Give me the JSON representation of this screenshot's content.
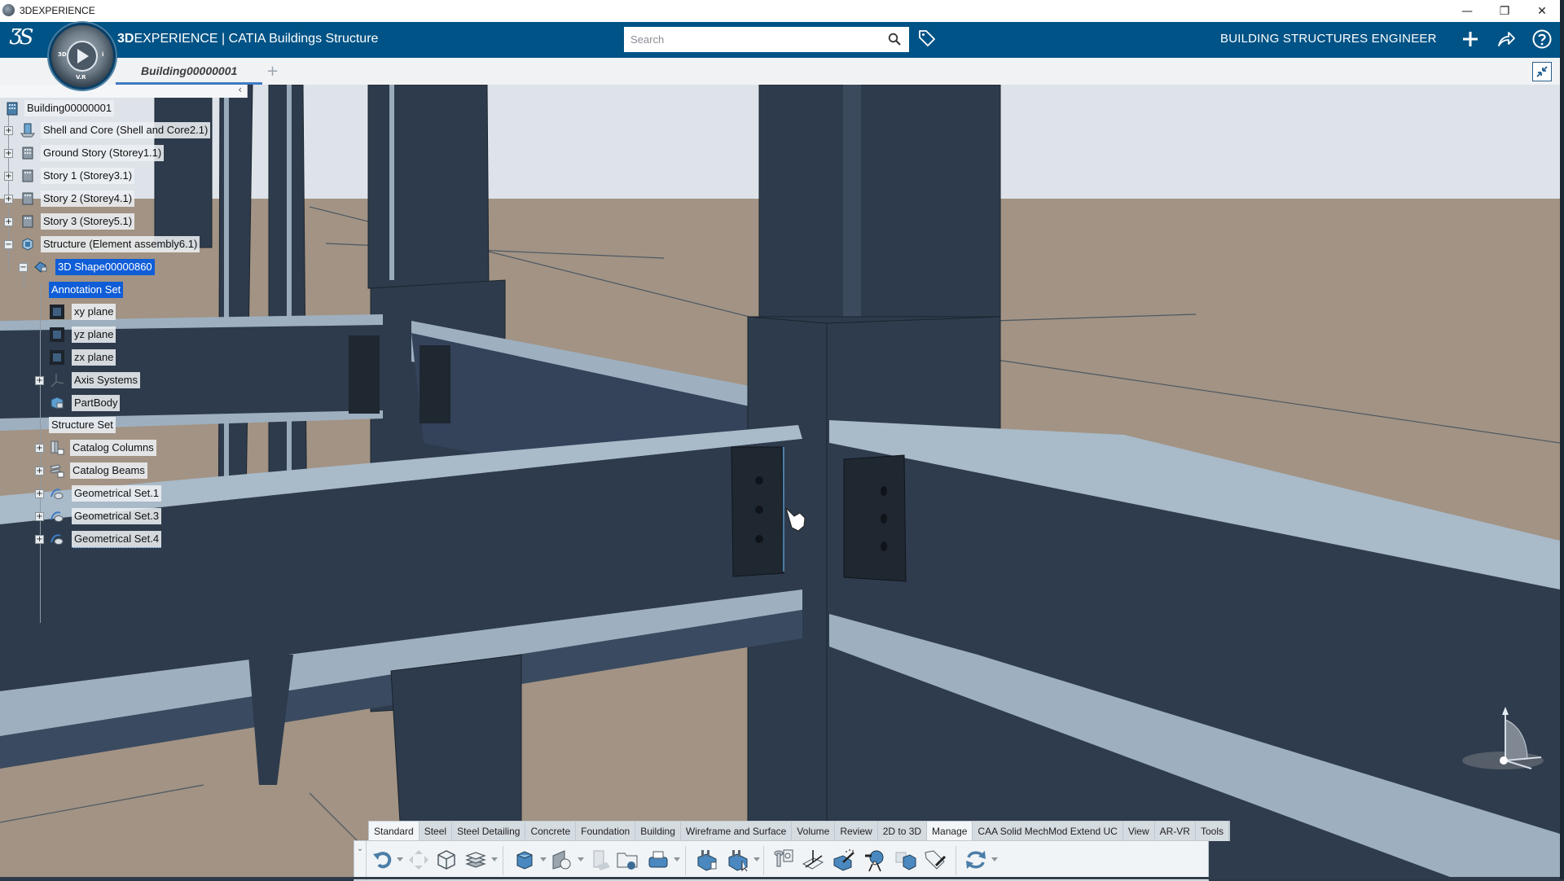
{
  "os_window": {
    "title": "3DEXPERIENCE",
    "controls": {
      "minimize": "—",
      "restore": "❐",
      "close": "✕"
    }
  },
  "header": {
    "brand_bold": "3D",
    "brand_rest": "EXPERIENCE",
    "separator": " | ",
    "app_name": "CATIA Buildings Structure",
    "compass_labels": {
      "left": "3D",
      "right": "i",
      "bottom": "V.R"
    },
    "search": {
      "placeholder": "Search",
      "value": ""
    },
    "role": "BUILDING STRUCTURES ENGINEER",
    "icons": [
      "tag-icon",
      "add-icon",
      "share-icon",
      "help-icon"
    ],
    "accent_color": "#005386"
  },
  "tabs": {
    "documents": [
      {
        "label": "Building00000001",
        "active": true
      }
    ],
    "add_label": "+"
  },
  "tree": {
    "collapse_glyph": "‹",
    "nodes": [
      {
        "label": "Building00000001",
        "level": 0,
        "expander": "",
        "icon": "building-icon",
        "selected": false
      },
      {
        "label": "Shell and Core (Shell and Core2.1)",
        "level": 1,
        "expander": "+",
        "icon": "shell-core-icon",
        "selected": false
      },
      {
        "label": "Ground Story (Storey1.1)",
        "level": 1,
        "expander": "+",
        "icon": "storey-icon",
        "selected": false
      },
      {
        "label": "Story 1 (Storey3.1)",
        "level": 1,
        "expander": "+",
        "icon": "storey-icon",
        "selected": false
      },
      {
        "label": "Story 2 (Storey4.1)",
        "level": 1,
        "expander": "+",
        "icon": "storey-icon",
        "selected": false
      },
      {
        "label": "Story 3 (Storey5.1)",
        "level": 1,
        "expander": "+",
        "icon": "storey-icon",
        "selected": false
      },
      {
        "label": "Structure (Element assembly6.1)",
        "level": 1,
        "expander": "−",
        "icon": "element-assembly-icon",
        "selected": false
      },
      {
        "label": "3D Shape00000860",
        "level": 2,
        "expander": "−",
        "icon": "3d-shape-icon",
        "selected": true
      },
      {
        "label": "Annotation Set",
        "level": 3,
        "expander": "",
        "icon": "",
        "selected": true
      },
      {
        "label": "xy plane",
        "level": 3,
        "expander": "",
        "icon": "plane-icon",
        "selected": false
      },
      {
        "label": "yz plane",
        "level": 3,
        "expander": "",
        "icon": "plane-icon",
        "selected": false
      },
      {
        "label": "zx plane",
        "level": 3,
        "expander": "",
        "icon": "plane-icon",
        "selected": false
      },
      {
        "label": "Axis Systems",
        "level": 3,
        "expander": "+",
        "icon": "axis-system-icon",
        "selected": false
      },
      {
        "label": "PartBody",
        "level": 3,
        "expander": "",
        "icon": "part-body-icon",
        "selected": false
      },
      {
        "label": "Structure Set",
        "level": 3,
        "expander": "",
        "icon": "",
        "selected": false
      },
      {
        "label": "Catalog Columns",
        "level": 3,
        "expander": "+",
        "icon": "catalog-columns-icon",
        "selected": false
      },
      {
        "label": "Catalog Beams",
        "level": 3,
        "expander": "+",
        "icon": "catalog-beams-icon",
        "selected": false
      },
      {
        "label": "Geometrical Set.1",
        "level": 3,
        "expander": "+",
        "icon": "geometrical-set-icon",
        "selected": false
      },
      {
        "label": "Geometrical Set.3",
        "level": 3,
        "expander": "+",
        "icon": "geometrical-set-icon",
        "selected": false
      },
      {
        "label": "Geometrical Set.4",
        "level": 3,
        "expander": "+",
        "icon": "geometrical-set-icon",
        "selected": false
      }
    ]
  },
  "viewport": {
    "sky_color": "#dde3e9",
    "ground_color": "#a29384",
    "steel_color": "#2e3b4c",
    "flange_color": "#9eb0c0",
    "plate_color": "#1f2731"
  },
  "action_bar": {
    "tabs": [
      {
        "label": "Standard",
        "active": true
      },
      {
        "label": "Steel",
        "active": false
      },
      {
        "label": "Steel Detailing",
        "active": false
      },
      {
        "label": "Concrete",
        "active": false
      },
      {
        "label": "Foundation",
        "active": false
      },
      {
        "label": "Building",
        "active": false
      },
      {
        "label": "Wireframe and Surface",
        "active": false
      },
      {
        "label": "Volume",
        "active": false
      },
      {
        "label": "Review",
        "active": false
      },
      {
        "label": "2D to 3D",
        "active": false
      },
      {
        "label": "Manage",
        "active": true
      },
      {
        "label": "CAA Solid MechMod Extend UC",
        "active": false
      },
      {
        "label": "View",
        "active": false
      },
      {
        "label": "AR-VR",
        "active": false
      },
      {
        "label": "Tools",
        "active": false
      }
    ],
    "collapse_glyph": "⌄",
    "tools": [
      {
        "name": "undo-icon",
        "dropdown": true
      },
      {
        "name": "update-icon",
        "dropdown": false
      },
      {
        "name": "3d-box-icon",
        "dropdown": false
      },
      {
        "name": "layers-icon",
        "dropdown": true
      },
      {
        "name": "solid-cube-icon",
        "dropdown": true
      },
      {
        "name": "create-shape-icon",
        "dropdown": true
      },
      {
        "name": "building-catalog-icon",
        "dropdown": false
      },
      {
        "name": "folder-catalog-icon",
        "dropdown": false
      },
      {
        "name": "print-icon",
        "dropdown": true
      },
      {
        "name": "structure-insert-icon",
        "dropdown": false
      },
      {
        "name": "structure-select-icon",
        "dropdown": true
      },
      {
        "name": "parameters-icon",
        "dropdown": false
      },
      {
        "name": "axis-system-tool-icon",
        "dropdown": false
      },
      {
        "name": "magic-wand-icon",
        "dropdown": false
      },
      {
        "name": "measure-icon",
        "dropdown": false
      },
      {
        "name": "cubes-icon",
        "dropdown": false
      },
      {
        "name": "tag-edit-icon",
        "dropdown": false
      },
      {
        "name": "refresh-icon",
        "dropdown": true
      }
    ]
  }
}
